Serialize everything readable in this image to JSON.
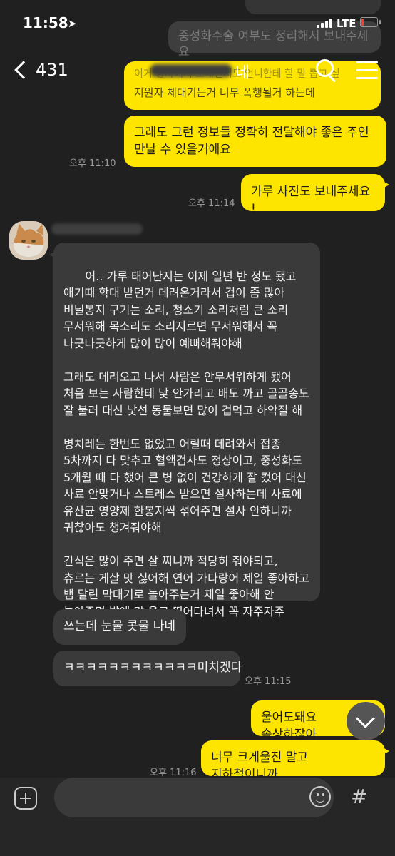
{
  "status_bar": {
    "time": "11:58",
    "location_icon": "location-arrow-icon",
    "network": "LTE",
    "battery_color": "#ff3b30"
  },
  "header": {
    "back_count": "431",
    "title_partial": "네",
    "search_icon": "search-icon",
    "menu_icon": "hamburger-menu-icon"
  },
  "messages": {
    "ghost_top": "중성화수술 여부도 정리해서 보내주세요",
    "ghost_behind": "이거 당사에서 보내면서도 언니한테 할 말 뽑고 싶",
    "m1": "지원자 체대기는거 너무 폭행될거 하는데",
    "m2": "그래도 그런 정보들 정확히 전달해야 좋은 주인 만날 수 있을거에요",
    "t1": "오후 11:10",
    "m3": "가루 사진도 보내주세요 !",
    "t2": "오후 11:14",
    "long_message": "어.. 가루 태어난지는 이제 일년 반 정도 됐고 애기때 학대 받던거 데려온거라서 겁이 좀 많아 비닐봉지 구기는 소리, 청소기 소리처럼 큰 소리 무서워해 목소리도 소리지르면 무서워해서 꼭 나긋나긋하게 많이 많이 예뻐해줘야해\n\n그래도 데려오고 나서 사람은 안무서워하게 됐어 처음 보는 사람한테 낯 안가리고 배도 까고 골골송도 잘 불러 대신 낯선 동물보면 많이 겁먹고 하악질 해\n\n병치레는 한번도 없었고 어릴때 데려와서 접종 5차까지 다 맞추고 혈액검사도 정상이고, 중성화도 5개월 때 다 했어 큰 병 없이 건강하게 잘 컸어 대신 사료 안맞거나 스트레스 받으면 설사하는데 사료에 유산균 영양제 한봉지씩 섞어주면 설사 안하니까 귀찮아도 챙겨줘야해\n\n간식은 많이 주면 살 찌니까 적당히 줘야되고, 츄르는 게살 맛 싫어해 연어 가다랑어 제일 좋아하고 뱀 달린 막대기로 놀아주는거 제일 좋아해 안 놀아주면 밤에 막 울고 뛰어다녀서 꼭 자주자주 놀아주고 예뻐해줘야해",
    "m5": "쓰는데 눈물 콧물 나네",
    "m6": "ㅋㅋㅋㅋㅋㅋㅋㅋㅋㅋㅋㅋ미치겠다",
    "t3": "오후 11:15",
    "m7": "울어도돼요 속상하잖아",
    "m8": "너무 크게울진 말고 지하철이니까",
    "t4": "오후 11:16"
  },
  "icons": {
    "avatar": "cat-avatar-icon",
    "scroll_down": "chevron-down-icon"
  },
  "input": {
    "placeholder": "",
    "plus_icon": "plus-icon",
    "emoji_icon": "emoji-icon",
    "hash_icon": "hash-icon",
    "hash_glyph": "#"
  },
  "colors": {
    "my_bubble": "#fee500",
    "their_bubble": "#3a3a3a",
    "background": "#202020"
  }
}
